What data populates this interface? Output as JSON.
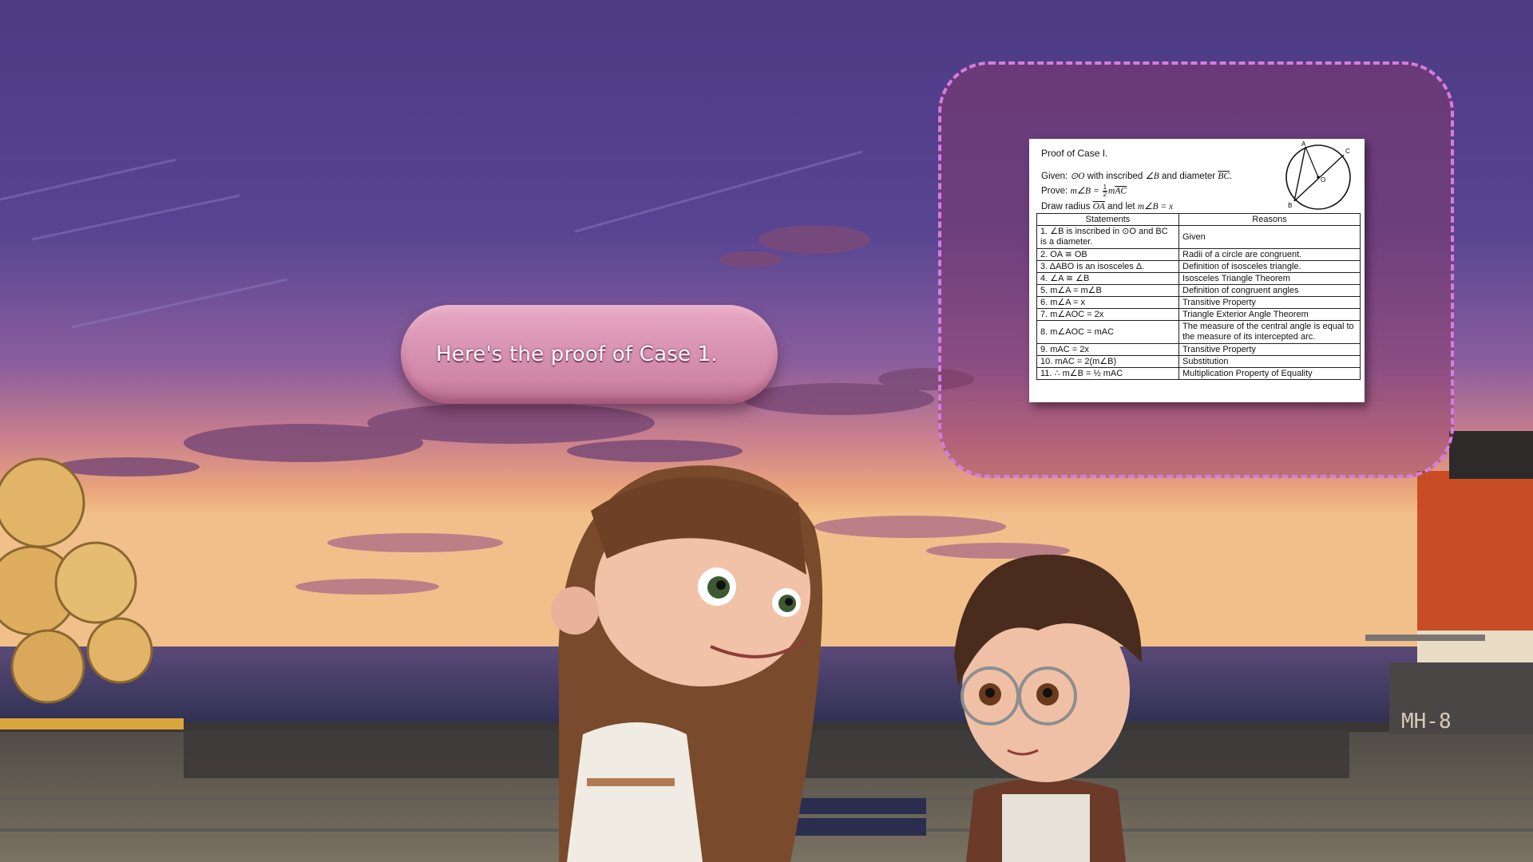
{
  "speech": {
    "text": "Here's the proof of Case 1."
  },
  "proof": {
    "title": "Proof of Case I.",
    "given": {
      "prefix": "Given: ",
      "circle": "⊙O",
      "mid": " with inscribed ",
      "angle": "∠B",
      "mid2": " and diameter ",
      "diameter": "BC",
      "end": "."
    },
    "prove": {
      "prefix": "Prove: ",
      "lhs": "m∠B = ",
      "num": "1",
      "den": "2",
      "arc_m": "m",
      "arc": "AC"
    },
    "draw": {
      "prefix": "Draw radius ",
      "radius": "OA",
      "mid": " and let ",
      "expr": "m∠B = x"
    },
    "diagram_labels": {
      "a": "A",
      "b": "B",
      "c": "C",
      "o": "O"
    },
    "table": {
      "headers": [
        "Statements",
        "Reasons"
      ],
      "rows": [
        {
          "statement": "1. ∠B is inscribed in ⊙O and BC is a diameter.",
          "reason": "Given"
        },
        {
          "statement": "2. OA ≅ OB",
          "reason": "Radii of a circle are congruent."
        },
        {
          "statement": "3. ΔABO is an isosceles Δ.",
          "reason": "Definition of isosceles triangle."
        },
        {
          "statement": "4.  ∠A ≅ ∠B",
          "reason": "Isosceles Triangle Theorem"
        },
        {
          "statement": "5. m∠A = m∠B",
          "reason": "Definition of congruent angles"
        },
        {
          "statement": "6.  m∠A = x",
          "reason": "Transitive Property"
        },
        {
          "statement": "7. m∠AOC = 2x",
          "reason": "Triangle Exterior Angle Theorem"
        },
        {
          "statement": "8. m∠AOC = mAC",
          "reason": "The measure of the central angle is equal to the measure of its intercepted arc."
        },
        {
          "statement": "9. mAC = 2x",
          "reason": "Transitive Property"
        },
        {
          "statement": "10. mAC = 2(m∠B)",
          "reason": "Substitution"
        },
        {
          "statement": "11. ∴ m∠B = ½ mAC",
          "reason": "Multiplication Property of Equality"
        }
      ]
    }
  },
  "scene": {
    "train_number": "MH-8",
    "sky_top": "#4e3a86",
    "sky_mid": "#7e5a9e",
    "sunset": "#e8a878",
    "sea": "#35345a",
    "dock": "#6b6556"
  }
}
